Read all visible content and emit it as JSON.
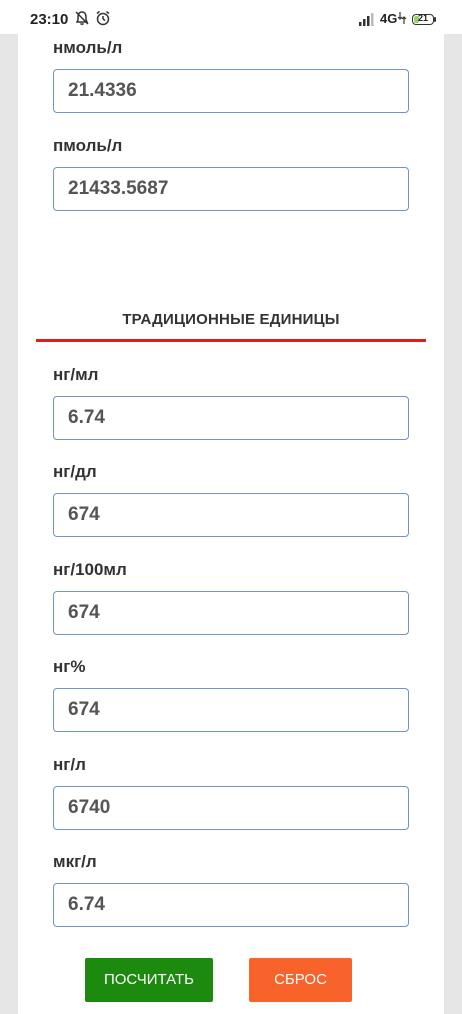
{
  "status_bar": {
    "time": "23:10",
    "icons": [
      "notifications-off-icon",
      "alarm-icon",
      "signal-icon",
      "wifi-icon"
    ],
    "network": "4G",
    "battery": "21"
  },
  "metric_fields": [
    {
      "label": "нмоль/л",
      "value": "21.4336"
    },
    {
      "label": "пмоль/л",
      "value": "21433.5687"
    }
  ],
  "traditional_section": {
    "title": "ТРАДИЦИОННЫЕ ЕДИНИЦЫ",
    "accent_color": "#e41b17"
  },
  "traditional_fields": [
    {
      "label": "нг/мл",
      "value": "6.74"
    },
    {
      "label": "нг/дл",
      "value": "674"
    },
    {
      "label": "нг/100мл",
      "value": "674"
    },
    {
      "label": "нг%",
      "value": "674"
    },
    {
      "label": "нг/л",
      "value": "6740"
    },
    {
      "label": "мкг/л",
      "value": "6.74"
    }
  ],
  "buttons": {
    "calculate": "ПОСЧИТАТЬ",
    "reset": "СБРОС",
    "calculate_color": "#1b8a0e",
    "reset_color": "#f7632b"
  }
}
